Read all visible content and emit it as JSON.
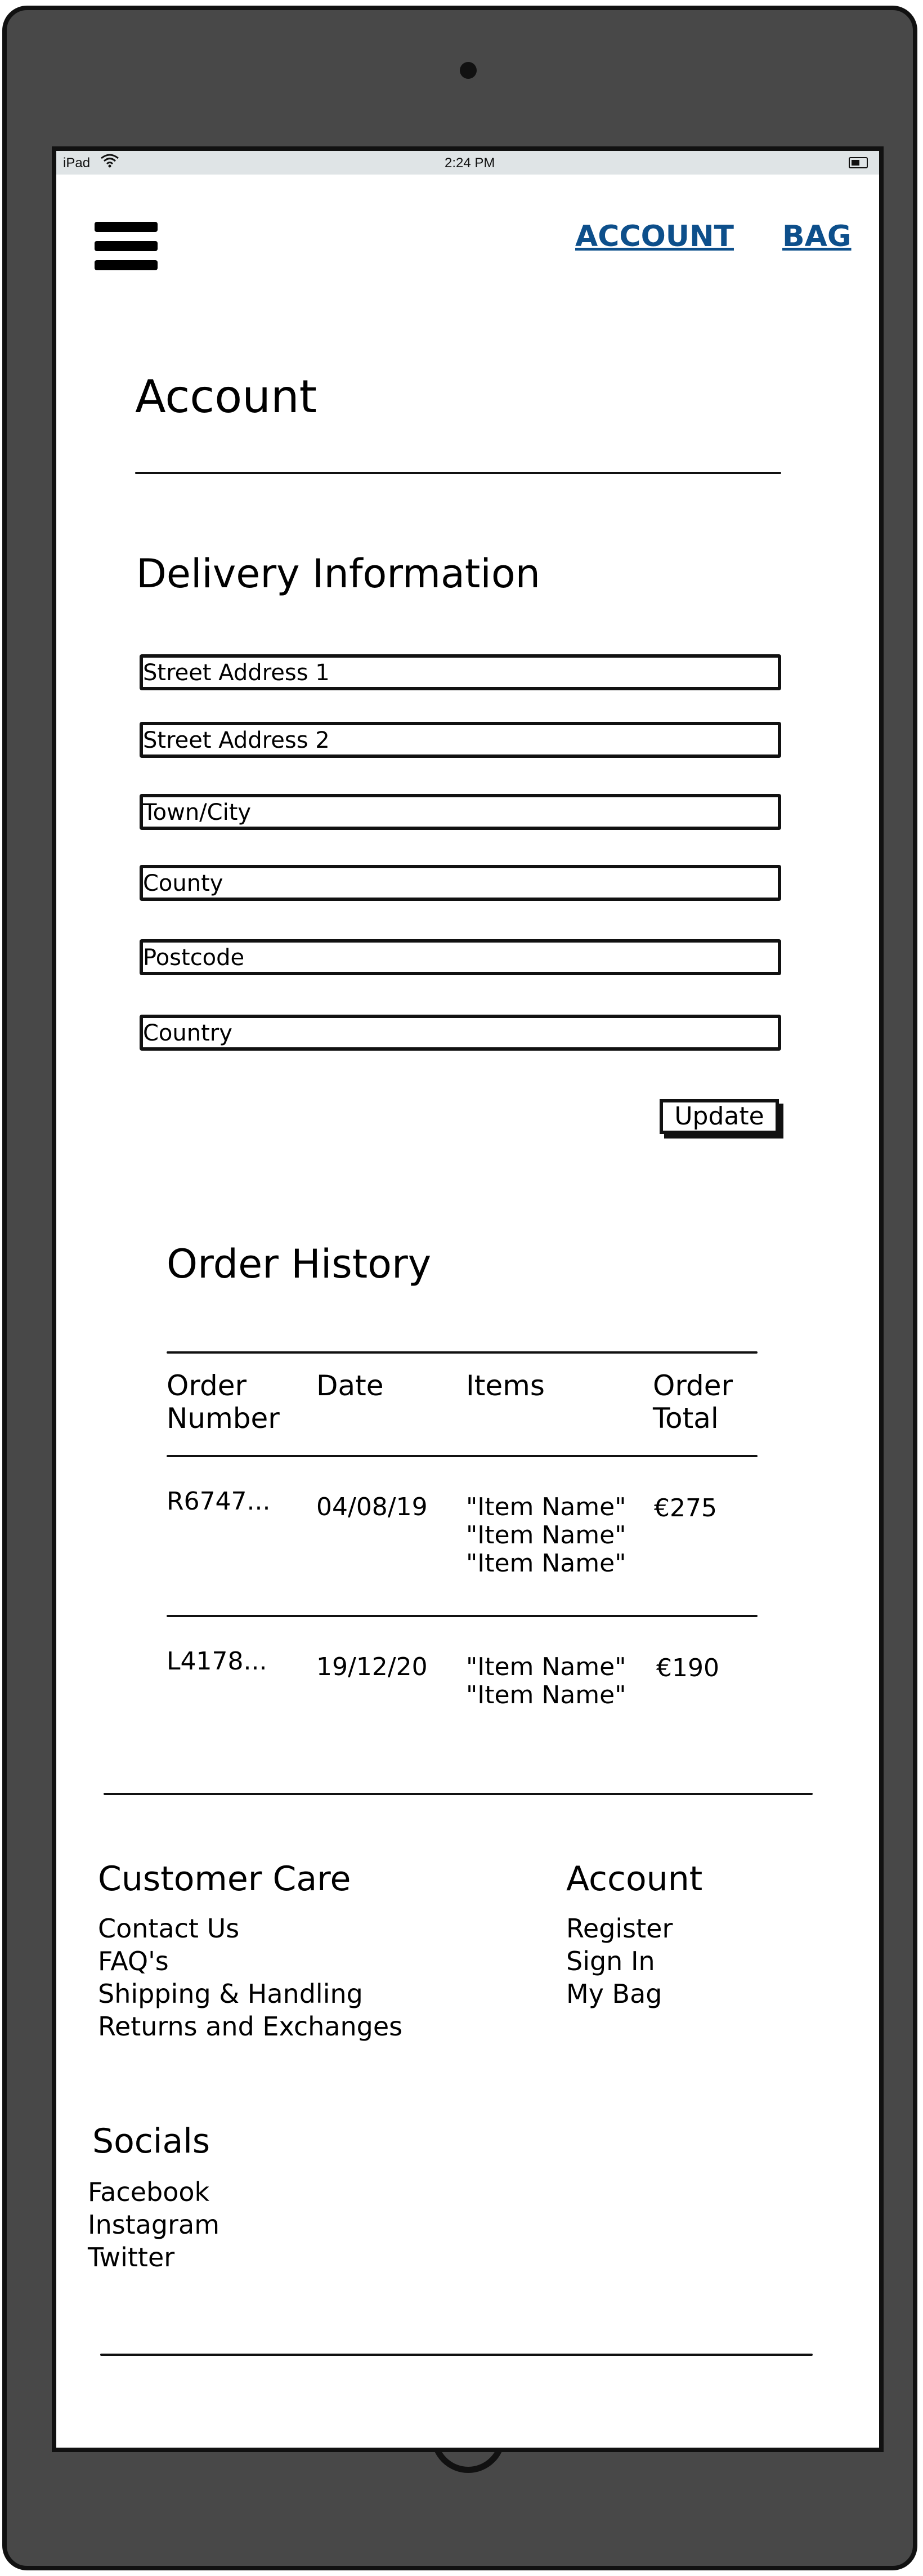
{
  "status_bar": {
    "device": "iPad",
    "time": "2:24 PM"
  },
  "nav": {
    "account_link": "ACCOUNT",
    "bag_link": "BAG"
  },
  "page": {
    "title": "Account"
  },
  "delivery": {
    "heading": "Delivery Information",
    "fields": {
      "street1": "Street Address 1",
      "street2": "Street Address 2",
      "town": "Town/City",
      "county": "County",
      "postcode": "Postcode",
      "country": "Country"
    },
    "update_label": "Update"
  },
  "orders": {
    "heading": "Order History",
    "columns": {
      "order_number_line1": "Order",
      "order_number_line2": "Number",
      "date": "Date",
      "items": "Items",
      "total_line1": "Order",
      "total_line2": "Total"
    },
    "rows": [
      {
        "number": "R6747...",
        "date": "04/08/19",
        "items": [
          "\"Item Name\"",
          "\"Item Name\"",
          "\"Item Name\""
        ],
        "total": "€275"
      },
      {
        "number": "L4178...",
        "date": "19/12/20",
        "items": [
          "\"Item Name\"",
          "\"Item Name\""
        ],
        "total": "€190"
      }
    ]
  },
  "footer": {
    "customer_care": {
      "heading": "Customer Care",
      "links": [
        "Contact Us",
        "FAQ's",
        "Shipping & Handling",
        "Returns and Exchanges"
      ]
    },
    "account": {
      "heading": "Account",
      "links": [
        "Register",
        "Sign In",
        "My Bag"
      ]
    },
    "socials": {
      "heading": "Socials",
      "links": [
        "Facebook",
        "Instagram",
        "Twitter"
      ]
    }
  },
  "colors": {
    "link": "#0d4f8b",
    "device_frame": "#484848",
    "status_bar": "#dfe4e6"
  }
}
